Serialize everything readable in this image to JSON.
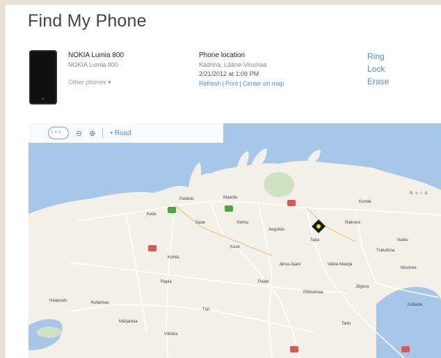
{
  "page": {
    "title": "Find My Phone"
  },
  "device": {
    "name": "NOKIA Lumia 800",
    "model": "NOKIA Lumia 800",
    "other_phones_label": "Other phones ▾"
  },
  "location": {
    "title": "Phone location",
    "place": "Kadrina, Lääne-Virumaa",
    "timestamp": "2/21/2012 at 1:09 PM",
    "links": {
      "refresh": "Refresh",
      "print": "Print",
      "center": "Center on map"
    }
  },
  "actions": {
    "ring": "Ring",
    "lock": "Lock",
    "erase": "Erase"
  },
  "map": {
    "toolbar": {
      "zoom_out": "⊖",
      "zoom_in": "⊕",
      "road_label": "• Road"
    },
    "sea_label": "Nord",
    "colors": {
      "sea": "#a7c7e9",
      "land": "#f3f0e8",
      "roads": "#ffffff",
      "marker": "#f4e51a"
    },
    "cities": [
      {
        "name": "Paldiski"
      },
      {
        "name": "Keila"
      },
      {
        "name": "Saue"
      },
      {
        "name": "Maardu"
      },
      {
        "name": "Kehra"
      },
      {
        "name": "Aegviidu"
      },
      {
        "name": "Tapa"
      },
      {
        "name": "Rakvere"
      },
      {
        "name": "Väike-Maarja"
      },
      {
        "name": "Kunda"
      },
      {
        "name": "Kohila"
      },
      {
        "name": "Kose"
      },
      {
        "name": "Järva-Jaani"
      },
      {
        "name": "Rapla"
      },
      {
        "name": "Türi"
      },
      {
        "name": "Paide"
      },
      {
        "name": "Haapsalu"
      },
      {
        "name": "Kullamaa"
      },
      {
        "name": "Märjamaa"
      },
      {
        "name": "Vändra"
      },
      {
        "name": "Põltsamaa"
      },
      {
        "name": "Jõgeva"
      },
      {
        "name": "Mustvee"
      },
      {
        "name": "Kallaste"
      },
      {
        "name": "Tartu"
      },
      {
        "name": "Iisaku"
      },
      {
        "name": "Tudulinna"
      }
    ]
  }
}
